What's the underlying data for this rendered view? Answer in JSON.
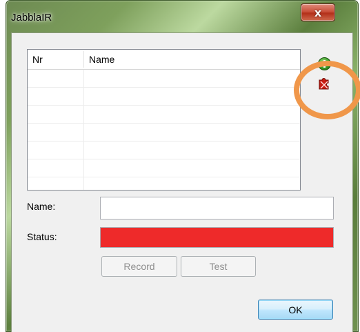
{
  "window": {
    "title": "JabblaIR",
    "close_symbol": "x"
  },
  "list": {
    "columns": [
      "Nr",
      "Name"
    ],
    "rows": []
  },
  "toolbar": {
    "add_icon": "green-plus-circle",
    "remove_icon": "red-puzzle-remove"
  },
  "form": {
    "name_label": "Name:",
    "name_value": "",
    "status_label": "Status:",
    "status_color": "#ee2a2a",
    "record_label": "Record",
    "test_label": "Test",
    "ok_label": "OK"
  },
  "annotation": {
    "highlight_color": "#f0974a"
  }
}
